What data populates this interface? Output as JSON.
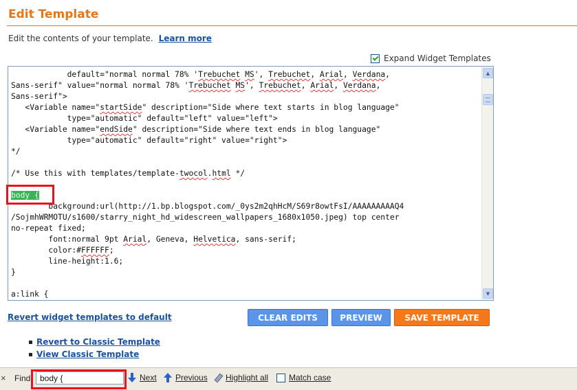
{
  "header": {
    "title": "Edit Template",
    "intro_text": "Edit the contents of your template.",
    "learn_more": "Learn more"
  },
  "expand_widgets": {
    "label": "Expand Widget Templates",
    "checked": true
  },
  "editor": {
    "lines": [
      [
        {
          "t": "            default=\"normal normal 78% '"
        },
        {
          "t": "Trebuchet",
          "sq": true
        },
        {
          "t": " "
        },
        {
          "t": "MS",
          "sq": true
        },
        {
          "t": "', "
        },
        {
          "t": "Trebuchet",
          "sq": true
        },
        {
          "t": ", "
        },
        {
          "t": "Arial",
          "sq": true
        },
        {
          "t": ", "
        },
        {
          "t": "Verdana",
          "sq": true
        },
        {
          "t": ","
        }
      ],
      [
        {
          "t": "Sans-serif\" value=\"normal normal 78% '"
        },
        {
          "t": "Trebuchet",
          "sq": true
        },
        {
          "t": " "
        },
        {
          "t": "MS",
          "sq": true
        },
        {
          "t": "', "
        },
        {
          "t": "Trebuchet",
          "sq": true
        },
        {
          "t": ", "
        },
        {
          "t": "Arial",
          "sq": true
        },
        {
          "t": ", "
        },
        {
          "t": "Verdana",
          "sq": true
        },
        {
          "t": ","
        }
      ],
      [
        {
          "t": "Sans-serif\">"
        }
      ],
      [
        {
          "t": "   <Variable name=\""
        },
        {
          "t": "startSide",
          "sq": true
        },
        {
          "t": "\" description=\"Side where text starts in blog language\""
        }
      ],
      [
        {
          "t": "            type=\"automatic\" default=\"left\" value=\"left\">"
        }
      ],
      [
        {
          "t": "   <Variable name=\""
        },
        {
          "t": "endSide",
          "sq": true
        },
        {
          "t": "\" description=\"Side where text ends in blog language\""
        }
      ],
      [
        {
          "t": "            type=\"automatic\" default=\"right\" value=\"right\">"
        }
      ],
      [
        {
          "t": "*/"
        }
      ],
      [
        {
          "t": ""
        }
      ],
      [
        {
          "t": "/* Use this with templates/template-"
        },
        {
          "t": "twocol",
          "sq": true
        },
        {
          "t": "."
        },
        {
          "t": "html",
          "sq": true
        },
        {
          "t": " */"
        }
      ],
      [
        {
          "t": ""
        }
      ],
      [
        {
          "t": "body {",
          "hl": true
        }
      ],
      [
        {
          "t": "        background:url(http://1.bp.blogspot.com/_0ys2m2qhHcM/S69r8owtFsI/AAAAAAAAAQ4"
        }
      ],
      [
        {
          "t": "/SojmhWRMOTU/s1600/starry_night_hd_widescreen_wallpapers_1680x1050.jpeg) top center"
        }
      ],
      [
        {
          "t": "no-repeat fixed;"
        }
      ],
      [
        {
          "t": "        font:normal 9pt "
        },
        {
          "t": "Arial",
          "sq": true
        },
        {
          "t": ", Geneva, "
        },
        {
          "t": "Helvetica",
          "sq": true
        },
        {
          "t": ", sans-serif;"
        }
      ],
      [
        {
          "t": "        color:#"
        },
        {
          "t": "FFFFFF",
          "sq": true
        },
        {
          "t": ";"
        }
      ],
      [
        {
          "t": "        line-height:1.6;"
        }
      ],
      [
        {
          "t": "}"
        }
      ],
      [
        {
          "t": ""
        }
      ],
      [
        {
          "t": "a:link {"
        }
      ]
    ]
  },
  "actions": {
    "revert_widgets": "Revert widget templates to default",
    "clear_edits": "CLEAR EDITS",
    "preview": "PREVIEW",
    "save_template": "SAVE TEMPLATE"
  },
  "links": {
    "revert_classic": "Revert to Classic Template",
    "view_classic": "View Classic Template"
  },
  "find_bar": {
    "close": "×",
    "label": "Find:",
    "query": "body {",
    "next": "Next",
    "previous": "Previous",
    "highlight_all": "Highlight all",
    "match_case": "Match case"
  },
  "colors": {
    "title_orange": "#e1771e",
    "link_blue": "#1a52a0",
    "button_blue": "#5b95e8",
    "button_orange": "#f5781a",
    "highlight_green": "#38b357",
    "annotation_red": "#e8121d"
  }
}
